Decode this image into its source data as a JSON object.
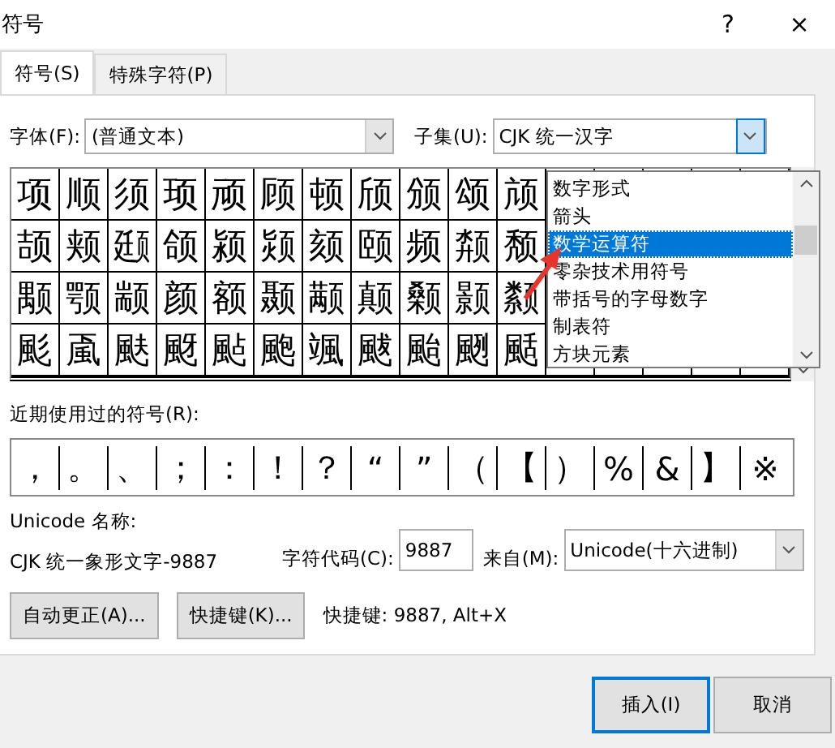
{
  "window": {
    "title": "符号",
    "help": "?",
    "close": "×"
  },
  "tabs": [
    {
      "label": "符号(S)",
      "selected": true
    },
    {
      "label": "特殊字符(P)",
      "selected": false
    }
  ],
  "font": {
    "label": "字体(F):",
    "value": "(普通文本)"
  },
  "subset": {
    "label": "子集(U):",
    "value": "CJK 统一汉字",
    "expanded": true,
    "options": [
      {
        "label": "数字形式",
        "selected": false
      },
      {
        "label": "箭头",
        "selected": false
      },
      {
        "label": "数学运算符",
        "selected": true
      },
      {
        "label": "零杂技术用符号",
        "selected": false
      },
      {
        "label": "带括号的字母数字",
        "selected": false
      },
      {
        "label": "制表符",
        "selected": false
      },
      {
        "label": "方块元素",
        "selected": false
      }
    ]
  },
  "grid": {
    "rows": [
      [
        "项",
        "顺",
        "须",
        "顼",
        "顽",
        "顾",
        "顿",
        "颀",
        "颁",
        "颂",
        "颃"
      ],
      [
        "颉",
        "颊",
        "颋",
        "颌",
        "颍",
        "颎",
        "颏",
        "颐",
        "频",
        "颒",
        "颓"
      ],
      [
        "颙",
        "颚",
        "颛",
        "颜",
        "额",
        "颞",
        "颟",
        "颠",
        "颡",
        "颢",
        "颣"
      ],
      [
        "颩",
        "颪",
        "颫",
        "颬",
        "颭",
        "颮",
        "颯",
        "颰",
        "颱",
        "颲",
        "颳"
      ]
    ]
  },
  "recent": {
    "label": "近期使用过的符号(R):",
    "symbols": [
      "，",
      "。",
      "、",
      "；",
      "：",
      "！",
      "？",
      "“",
      "”",
      "（",
      "【",
      "）",
      "%",
      "&",
      "】",
      "※"
    ]
  },
  "unicode_name": {
    "label": "Unicode 名称:",
    "value": "CJK 统一象形文字-9887"
  },
  "char_code": {
    "label": "字符代码(C):",
    "value": "9887"
  },
  "from": {
    "label": "来自(M):",
    "value": "Unicode(十六进制)"
  },
  "buttons": [
    {
      "label": "自动更正(A)..."
    },
    {
      "label": "快捷键(K)..."
    }
  ],
  "shortcut": "快捷键: 9887, Alt+X",
  "footer_buttons": [
    {
      "label": "插入(I)",
      "default": true
    },
    {
      "label": "取消",
      "default": false
    }
  ]
}
